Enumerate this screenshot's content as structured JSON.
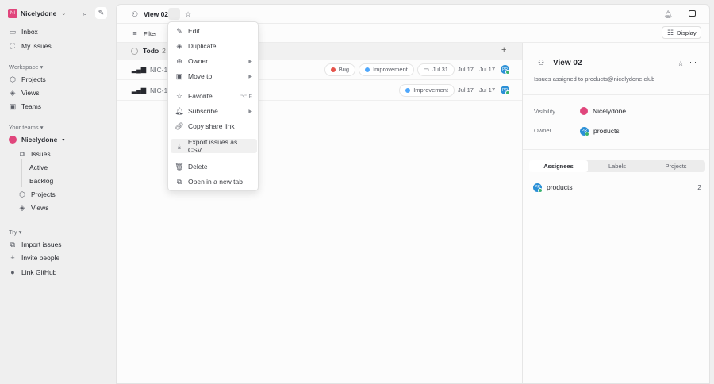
{
  "workspace": {
    "initials": "NI",
    "name": "Nicelydone"
  },
  "sidebar": {
    "top": [
      {
        "label": "Inbox"
      },
      {
        "label": "My issues"
      }
    ],
    "workspace_label": "Workspace",
    "workspace_items": [
      {
        "label": "Projects"
      },
      {
        "label": "Views"
      },
      {
        "label": "Teams"
      }
    ],
    "teams_label": "Your teams",
    "team": {
      "name": "Nicelydone",
      "items": [
        {
          "label": "Issues"
        },
        {
          "label": "Active"
        },
        {
          "label": "Backlog"
        },
        {
          "label": "Projects"
        },
        {
          "label": "Views"
        }
      ]
    },
    "try_label": "Try",
    "try_items": [
      {
        "label": "Import issues"
      },
      {
        "label": "Invite people"
      },
      {
        "label": "Link GitHub"
      }
    ]
  },
  "header": {
    "view_title": "View 02",
    "filter": "Filter",
    "display": "Display"
  },
  "group": {
    "label": "Todo",
    "count": "2"
  },
  "issues": [
    {
      "id": "NIC-11",
      "labels": [
        {
          "name": "Bug",
          "color": "#e5534b"
        },
        {
          "name": "Improvement",
          "color": "#4ea7fc"
        }
      ],
      "due": "Jul 31",
      "created": "Jul 17",
      "updated": "Jul 17",
      "avatar": "PR"
    },
    {
      "id": "NIC-12",
      "labels": [
        {
          "name": "Improvement",
          "color": "#4ea7fc"
        }
      ],
      "created": "Jul 17",
      "updated": "Jul 17",
      "avatar": "PR"
    }
  ],
  "menu": [
    {
      "label": "Edit..."
    },
    {
      "label": "Duplicate..."
    },
    {
      "label": "Owner"
    },
    {
      "label": "Move to"
    },
    {
      "label": "Favorite",
      "shortcut": "⌥ F"
    },
    {
      "label": "Subscribe"
    },
    {
      "label": "Copy share link"
    },
    {
      "label": "Export issues as CSV..."
    },
    {
      "label": "Delete"
    },
    {
      "label": "Open in a new tab"
    }
  ],
  "panel": {
    "title": "View 02",
    "description": "Issues assigned to products@nicelydone.club",
    "visibility_label": "Visibility",
    "visibility_value": "Nicelydone",
    "owner_label": "Owner",
    "owner_value": "products",
    "owner_avatar": "PR",
    "tabs": [
      "Assignees",
      "Labels",
      "Projects"
    ],
    "assignees": [
      {
        "name": "products",
        "count": "2",
        "avatar": "PR"
      }
    ]
  }
}
